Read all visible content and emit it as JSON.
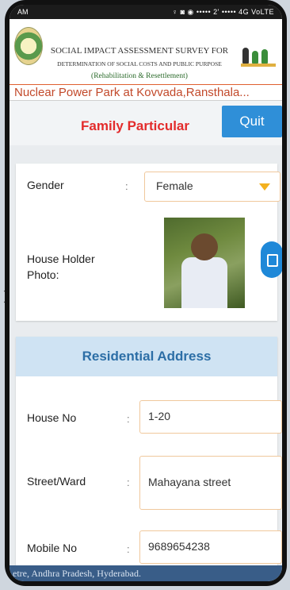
{
  "status_bar": {
    "left": "AM",
    "right": "♀ ◙ ◉ ••••• 2' ••••• 4G VoLTE"
  },
  "header": {
    "title_line1": "SOCIAL IMPACT ASSESSMENT SURVEY FOR",
    "title_line2": "DETERMINATION OF SOCIAL COSTS AND PUBLIC PURPOSE",
    "title_line3": "(Rehabilitation & Resettlement)",
    "project": "Nuclear Power Park at Kovvada,Ransthala..."
  },
  "section": {
    "title": "Family Particular",
    "quit_label": "Quit"
  },
  "form": {
    "gender_label": "Gender",
    "gender_value": "Female",
    "photo_label": "House Holder\nPhoto:",
    "colon": ":"
  },
  "address": {
    "heading": "Residential Address",
    "house_label": "House No",
    "house_value": "1-20",
    "street_label": "Street/Ward",
    "street_value": "Mahayana street",
    "mobile_label": "Mobile No",
    "mobile_value": "9689654238"
  },
  "footer": {
    "text": "etre, Andhra Pradesh, Hyderabad."
  },
  "colors": {
    "quit": "#2f8fd8",
    "section_title": "#e32b2b",
    "address_head_bg": "#cfe3f3"
  }
}
